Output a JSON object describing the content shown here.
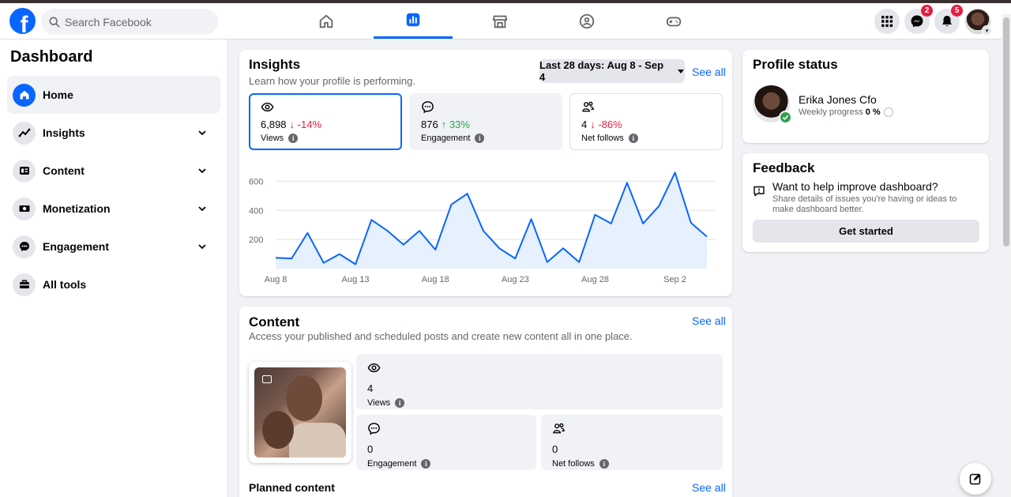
{
  "header": {
    "search_placeholder": "Search Facebook",
    "messenger_badge": "2",
    "notifications_badge": "5"
  },
  "sidebar": {
    "title": "Dashboard",
    "items": [
      {
        "label": "Home"
      },
      {
        "label": "Insights"
      },
      {
        "label": "Content"
      },
      {
        "label": "Monetization"
      },
      {
        "label": "Engagement"
      },
      {
        "label": "All tools"
      }
    ]
  },
  "insights": {
    "title": "Insights",
    "subtitle": "Learn how your profile is performing.",
    "range": "Last 28 days: Aug 8 - Sep 4",
    "see_all": "See all",
    "metrics": [
      {
        "value": "6,898",
        "change": "↓ -14%",
        "label": "Views"
      },
      {
        "value": "876",
        "change": "↑ 33%",
        "label": "Engagement"
      },
      {
        "value": "4",
        "change": "↓ -86%",
        "label": "Net follows"
      }
    ]
  },
  "content": {
    "title": "Content",
    "subtitle": "Access your published and scheduled posts and create new content all in one place.",
    "see_all": "See all",
    "views_value": "4",
    "views_label": "Views",
    "engagement_value": "0",
    "engagement_label": "Engagement",
    "follows_value": "0",
    "follows_label": "Net follows",
    "planned_title": "Planned content",
    "planned_see_all": "See all"
  },
  "profile_status": {
    "title": "Profile status",
    "name": "Erika Jones Cfo",
    "progress_label": "Weekly progress",
    "progress_value": "0 %"
  },
  "feedback": {
    "title": "Feedback",
    "question": "Want to help improve dashboard?",
    "description": "Share details of issues you're having or ideas to make dashboard better.",
    "button": "Get started"
  },
  "chart_data": {
    "type": "area",
    "title": "",
    "xlabel": "",
    "ylabel": "",
    "x": [
      "Aug 8",
      "Aug 9",
      "Aug 10",
      "Aug 11",
      "Aug 12",
      "Aug 13",
      "Aug 14",
      "Aug 15",
      "Aug 16",
      "Aug 17",
      "Aug 18",
      "Aug 19",
      "Aug 20",
      "Aug 21",
      "Aug 22",
      "Aug 23",
      "Aug 24",
      "Aug 25",
      "Aug 26",
      "Aug 27",
      "Aug 28",
      "Aug 29",
      "Aug 30",
      "Aug 31",
      "Sep 1",
      "Sep 2",
      "Sep 3",
      "Sep 4"
    ],
    "x_tick_labels": [
      "Aug 8",
      "Aug 13",
      "Aug 18",
      "Aug 23",
      "Aug 28",
      "Sep 2"
    ],
    "y_tick_labels": [
      "200",
      "400",
      "600"
    ],
    "ylim": [
      0,
      700
    ],
    "series": [
      {
        "values": [
          75,
          70,
          245,
          40,
          100,
          30,
          335,
          260,
          165,
          260,
          130,
          440,
          515,
          260,
          140,
          70,
          340,
          45,
          140,
          45,
          370,
          310,
          590,
          310,
          430,
          660,
          315,
          220
        ]
      }
    ],
    "grid": true,
    "color": "#0866ff"
  }
}
